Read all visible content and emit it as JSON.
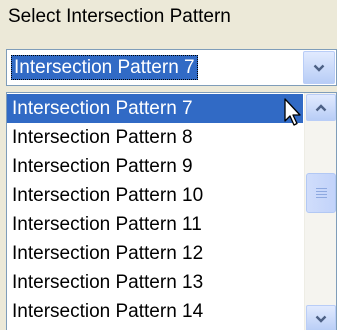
{
  "caption": "Select Intersection Pattern",
  "combo": {
    "value": "Intersection Pattern 7",
    "dropdown_icon": "chevron-down-icon"
  },
  "list": {
    "selected_index": 0,
    "items": [
      "Intersection Pattern 7",
      "Intersection Pattern 8",
      "Intersection Pattern 9",
      "Intersection Pattern 10",
      "Intersection Pattern 11",
      "Intersection Pattern 12",
      "Intersection Pattern 13",
      "Intersection Pattern 14"
    ]
  },
  "scrollbar": {
    "up_icon": "chevron-up-icon",
    "down_icon": "chevron-down-icon"
  },
  "colors": {
    "selection": "#316ac5",
    "arrow": "#4d6185",
    "border": "#7f9db9"
  }
}
